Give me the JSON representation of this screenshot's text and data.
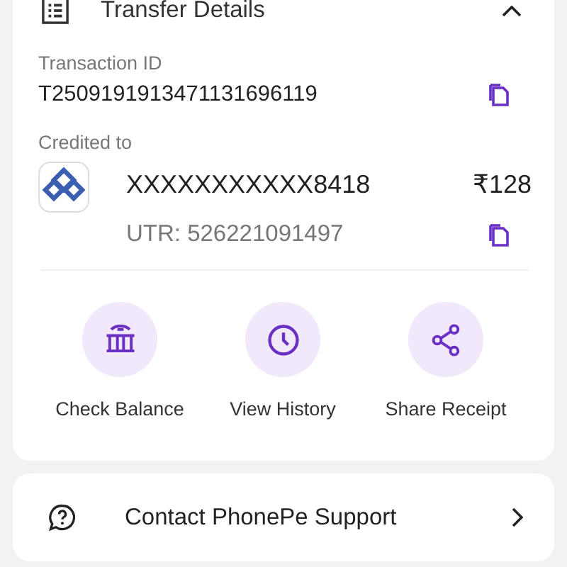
{
  "transfer_details": {
    "title": "Transfer Details",
    "expanded": true,
    "transaction": {
      "label": "Transaction ID",
      "value": "T2509191913471131696119"
    },
    "credited": {
      "label": "Credited to",
      "account": "XXXXXXXXXXX8418",
      "amount": "₹128",
      "utr": "UTR: 526221091497"
    },
    "actions": [
      {
        "kind": "bank",
        "label": "Check Balance"
      },
      {
        "kind": "history",
        "label": "View History"
      },
      {
        "kind": "share",
        "label": "Share Receipt"
      }
    ]
  },
  "support": {
    "label": "Contact PhonePe Support"
  }
}
